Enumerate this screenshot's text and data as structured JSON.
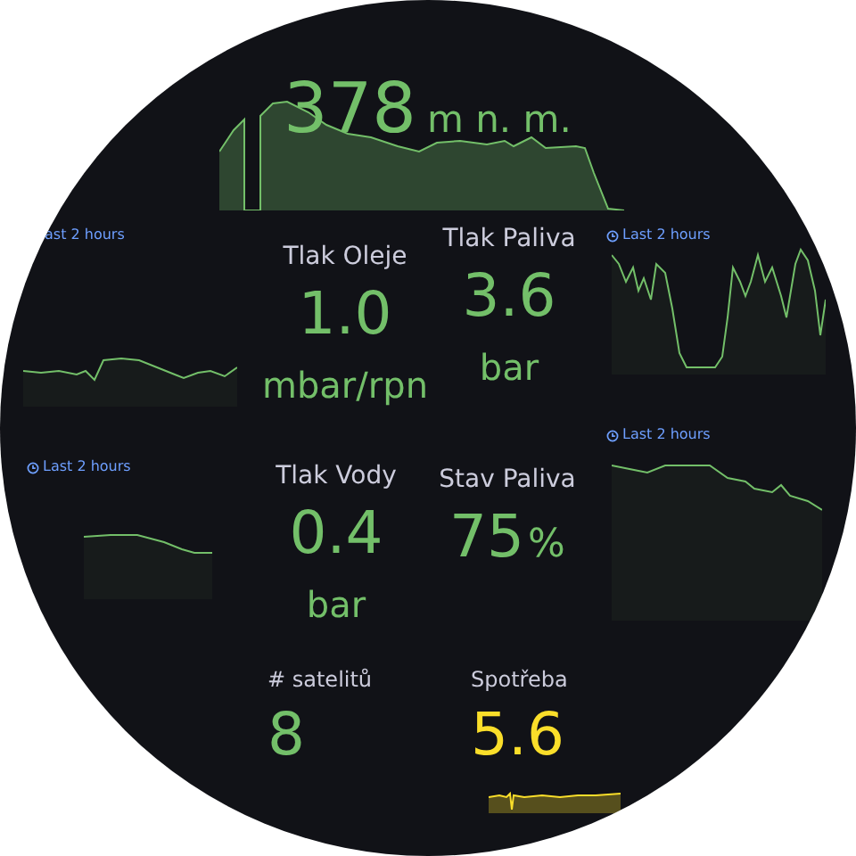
{
  "altitude": {
    "value": "378",
    "unit": "m n. m."
  },
  "graph_panels": [
    {
      "time_range": "ast 2 hours",
      "icon": false
    },
    {
      "time_range": "Last 2 hours",
      "icon": true
    },
    {
      "time_range": "Last 2 hours",
      "icon": true
    },
    {
      "time_range": "Last 2 hours",
      "icon": true
    }
  ],
  "stats": [
    {
      "kind": "stacked",
      "title": "Tlak Oleje",
      "value": "1.0",
      "unit": "mbar/rpn",
      "color": "#73bf69"
    },
    {
      "kind": "stacked",
      "title": "Tlak Paliva",
      "value": "3.6",
      "unit": "bar",
      "color": "#73bf69"
    },
    {
      "kind": "stacked",
      "title": "Tlak Vody",
      "value": "0.4",
      "unit": "bar",
      "color": "#73bf69"
    },
    {
      "kind": "inline",
      "title": "Stav Paliva",
      "value": "75",
      "unit": "%",
      "color": "#73bf69"
    },
    {
      "kind": "plain",
      "title": "# satelitů",
      "value": "8",
      "color": "#73bf69"
    },
    {
      "kind": "plain",
      "title": "Spotřeba",
      "value": "5.6",
      "color": "#fade2a"
    }
  ]
}
